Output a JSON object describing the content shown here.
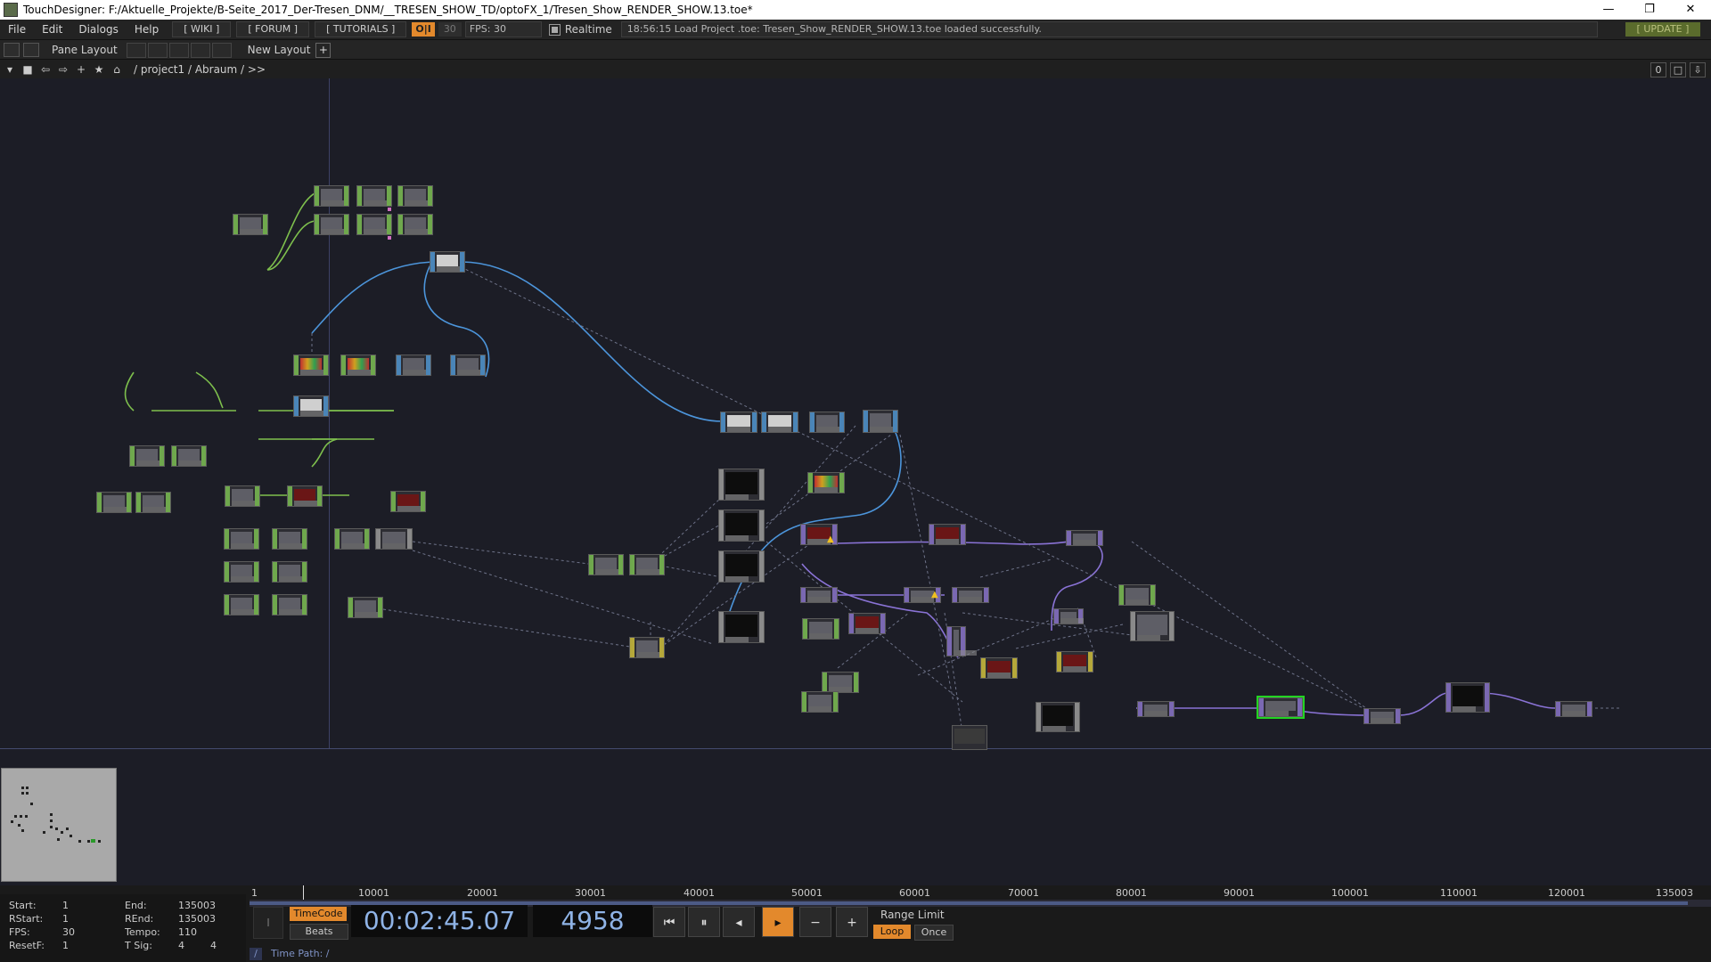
{
  "window": {
    "title": "TouchDesigner: F:/Aktuelle_Projekte/B-Seite_2017_Der-Tresen_DNM/__TRESEN_SHOW_TD/optoFX_1/Tresen_Show_RENDER_SHOW.13.toe*",
    "controls": [
      "—",
      "❐",
      "✕"
    ]
  },
  "menu": {
    "items": [
      "File",
      "Edit",
      "Dialogs",
      "Help"
    ],
    "wiki": "[ WIKI ]",
    "forum": "[ FORUM ]",
    "tutorials": "[ TUTORIALS ]",
    "oi": "O|I",
    "fps_num": "30",
    "fps_field": "FPS:  30",
    "realtime": "Realtime",
    "status": "18:56:15 Load Project .toe: Tresen_Show_RENDER_SHOW.13.toe loaded successfully.",
    "update": "[ UPDATE ]"
  },
  "panebar": {
    "pane_layout": "Pane Layout",
    "new_layout": "New Layout",
    "plus": "+"
  },
  "pathbar": {
    "path": "/ project1 / Abraum / >>",
    "zero": "0"
  },
  "timeline": {
    "ruler_ticks": [
      "1",
      "10001",
      "20001",
      "30001",
      "40001",
      "50001",
      "60001",
      "70001",
      "80001",
      "90001",
      "100001",
      "110001",
      "120001",
      "135003"
    ],
    "start_label": "Start:",
    "start_val": "1",
    "end_label": "End:",
    "end_val": "135003",
    "rstart_label": "RStart:",
    "rstart_val": "1",
    "rend_label": "REnd:",
    "rend_val": "135003",
    "fps_label": "FPS:",
    "fps_val": "30",
    "tempo_label": "Tempo:",
    "tempo_val": "110",
    "resetf_label": "ResetF:",
    "resetf_val": "1",
    "tsig_label": "T Sig:",
    "tsig_a": "4",
    "tsig_b": "4",
    "timecode_btn": "TimeCode",
    "beats_btn": "Beats",
    "clock": "00:02:45.07",
    "frame": "4958",
    "range_limit": "Range Limit",
    "loop": "Loop",
    "once": "Once",
    "time_path": "Time Path: /",
    "slash": "/"
  },
  "colors": {
    "chop": "#6fa84d",
    "top": "#4a85b8",
    "sop": "#7a68b2",
    "dat": "#b5a83a",
    "accent": "#e3892c"
  }
}
